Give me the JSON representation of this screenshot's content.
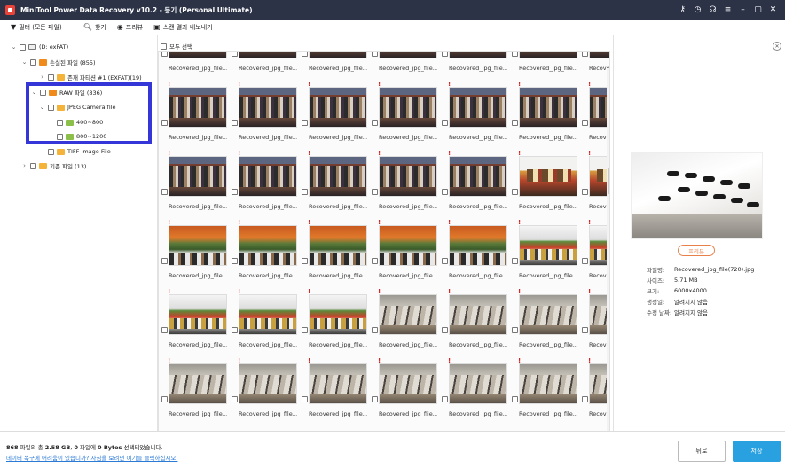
{
  "window": {
    "title": "MiniTool Power Data Recovery v10.2 - 등기 (Personal Ultimate)",
    "controls": [
      "key-icon",
      "clock-icon",
      "headset-icon",
      "menu-icon",
      "minimize-icon",
      "maximize-icon",
      "close-icon"
    ]
  },
  "toolbar": {
    "filter_label": "필터 (모든 파일)",
    "search_label": "찾기",
    "preview_label": "프리뷰",
    "export_label": "스캔 결과 내보내기"
  },
  "tree": {
    "drive": "(D: exFAT)",
    "lost_files": "손실된 파일 (855)",
    "partition": "존재 파티션 #1 (EXFAT)(19)",
    "raw_files": "RAW 파일 (836)",
    "jpeg_camera": "JPEG Camera file",
    "size_400_800": "400~800",
    "size_800_1200": "800~1200",
    "tiff": "TIFF Image File",
    "existing": "기존 파일 (13)"
  },
  "center": {
    "select_all": "모두 선택",
    "caption": "Recovered_jpg_file...",
    "rows": [
      [
        "clothes",
        "clothes",
        "clothes",
        "clothes",
        "clothes",
        "clothes",
        "clothes",
        "clothes"
      ],
      [
        "clothes",
        "clothes",
        "clothes",
        "clothes",
        "clothes",
        "toys",
        "toys",
        "toys"
      ],
      [
        "plant",
        "plant",
        "plant",
        "plant",
        "plant",
        "fruit",
        "fruit",
        "fruit"
      ],
      [
        "fruit",
        "fruit",
        "fruit",
        "mall",
        "mall",
        "mall",
        "mall",
        "mall"
      ],
      [
        "mall",
        "mall",
        "mall",
        "mall",
        "mall",
        "mall",
        "mall",
        "mall"
      ]
    ]
  },
  "preview": {
    "button": "프리뷰",
    "info": [
      {
        "k": "파일명:",
        "v": "Recovered_jpg_file(720).jpg"
      },
      {
        "k": "사이즈:",
        "v": "5.71 MB"
      },
      {
        "k": "크기:",
        "v": "6000x4000"
      },
      {
        "k": "생성일:",
        "v": "알려지지 않음"
      },
      {
        "k": "수정 날짜:",
        "v": "알려지지 않음"
      }
    ]
  },
  "footer": {
    "summary_count": "868",
    "summary_text1": " 파일의 총 ",
    "summary_size": "2.58 GB",
    "summary_text2": ", ",
    "summary_selected": "0",
    "summary_text3": " 파일에 ",
    "summary_bytes": "0 Bytes",
    "summary_text4": " 선택되었습니다.",
    "help_link": "데이터 복구에 어려움이 있습니까? 자침을 보려면 여기를 클릭하십시오.",
    "back_label": "뒤로",
    "save_label": "저장"
  },
  "colors": {
    "titlebar": "#2c3347",
    "highlight": "#3436d8",
    "save": "#29a0e0",
    "accent": "#e8804a"
  }
}
